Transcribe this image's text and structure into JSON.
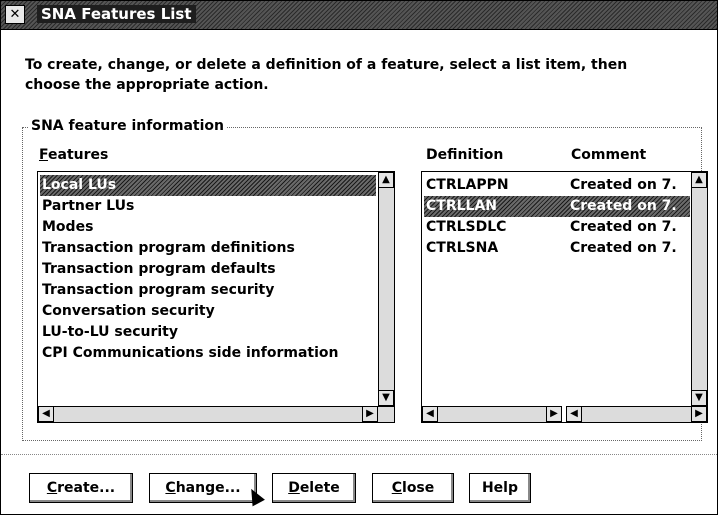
{
  "window": {
    "title": "SNA Features List",
    "sysmenu_glyph": "✕"
  },
  "instructions": "To create, change, or delete a definition of a feature, select a list item, then choose the appropriate action.",
  "group": {
    "label": "SNA feature information",
    "features_header": "Features",
    "features_header_mnemonic": "F",
    "features_header_rest": "eatures",
    "definition_header": "Definition",
    "comment_header": "Comment",
    "features": [
      "Local LUs",
      "Partner LUs",
      "Modes",
      "Transaction program definitions",
      "Transaction program defaults",
      "Transaction program security",
      "Conversation security",
      "LU-to-LU security",
      "CPI Communications side information"
    ],
    "features_selected": "Local LUs",
    "definitions": [
      {
        "definition": "CTRLAPPN",
        "comment": "Created on 7."
      },
      {
        "definition": "CTRLLAN",
        "comment": "Created on 7."
      },
      {
        "definition": "CTRLSDLC",
        "comment": "Created on 7."
      },
      {
        "definition": "CTRLSNA",
        "comment": "Created on 7."
      }
    ],
    "definition_selected": "CTRLLAN"
  },
  "buttons": {
    "create": {
      "label": "Create...",
      "mnemonic": "C",
      "rest": "reate..."
    },
    "change": {
      "label": "Change...",
      "mnemonic": "C",
      "rest": "hange..."
    },
    "delete": {
      "label": "Delete",
      "mnemonic": "D",
      "rest": "elete"
    },
    "close": {
      "label": "Close",
      "mnemonic": "C",
      "rest": "lose"
    },
    "help": {
      "label": "Help"
    }
  }
}
